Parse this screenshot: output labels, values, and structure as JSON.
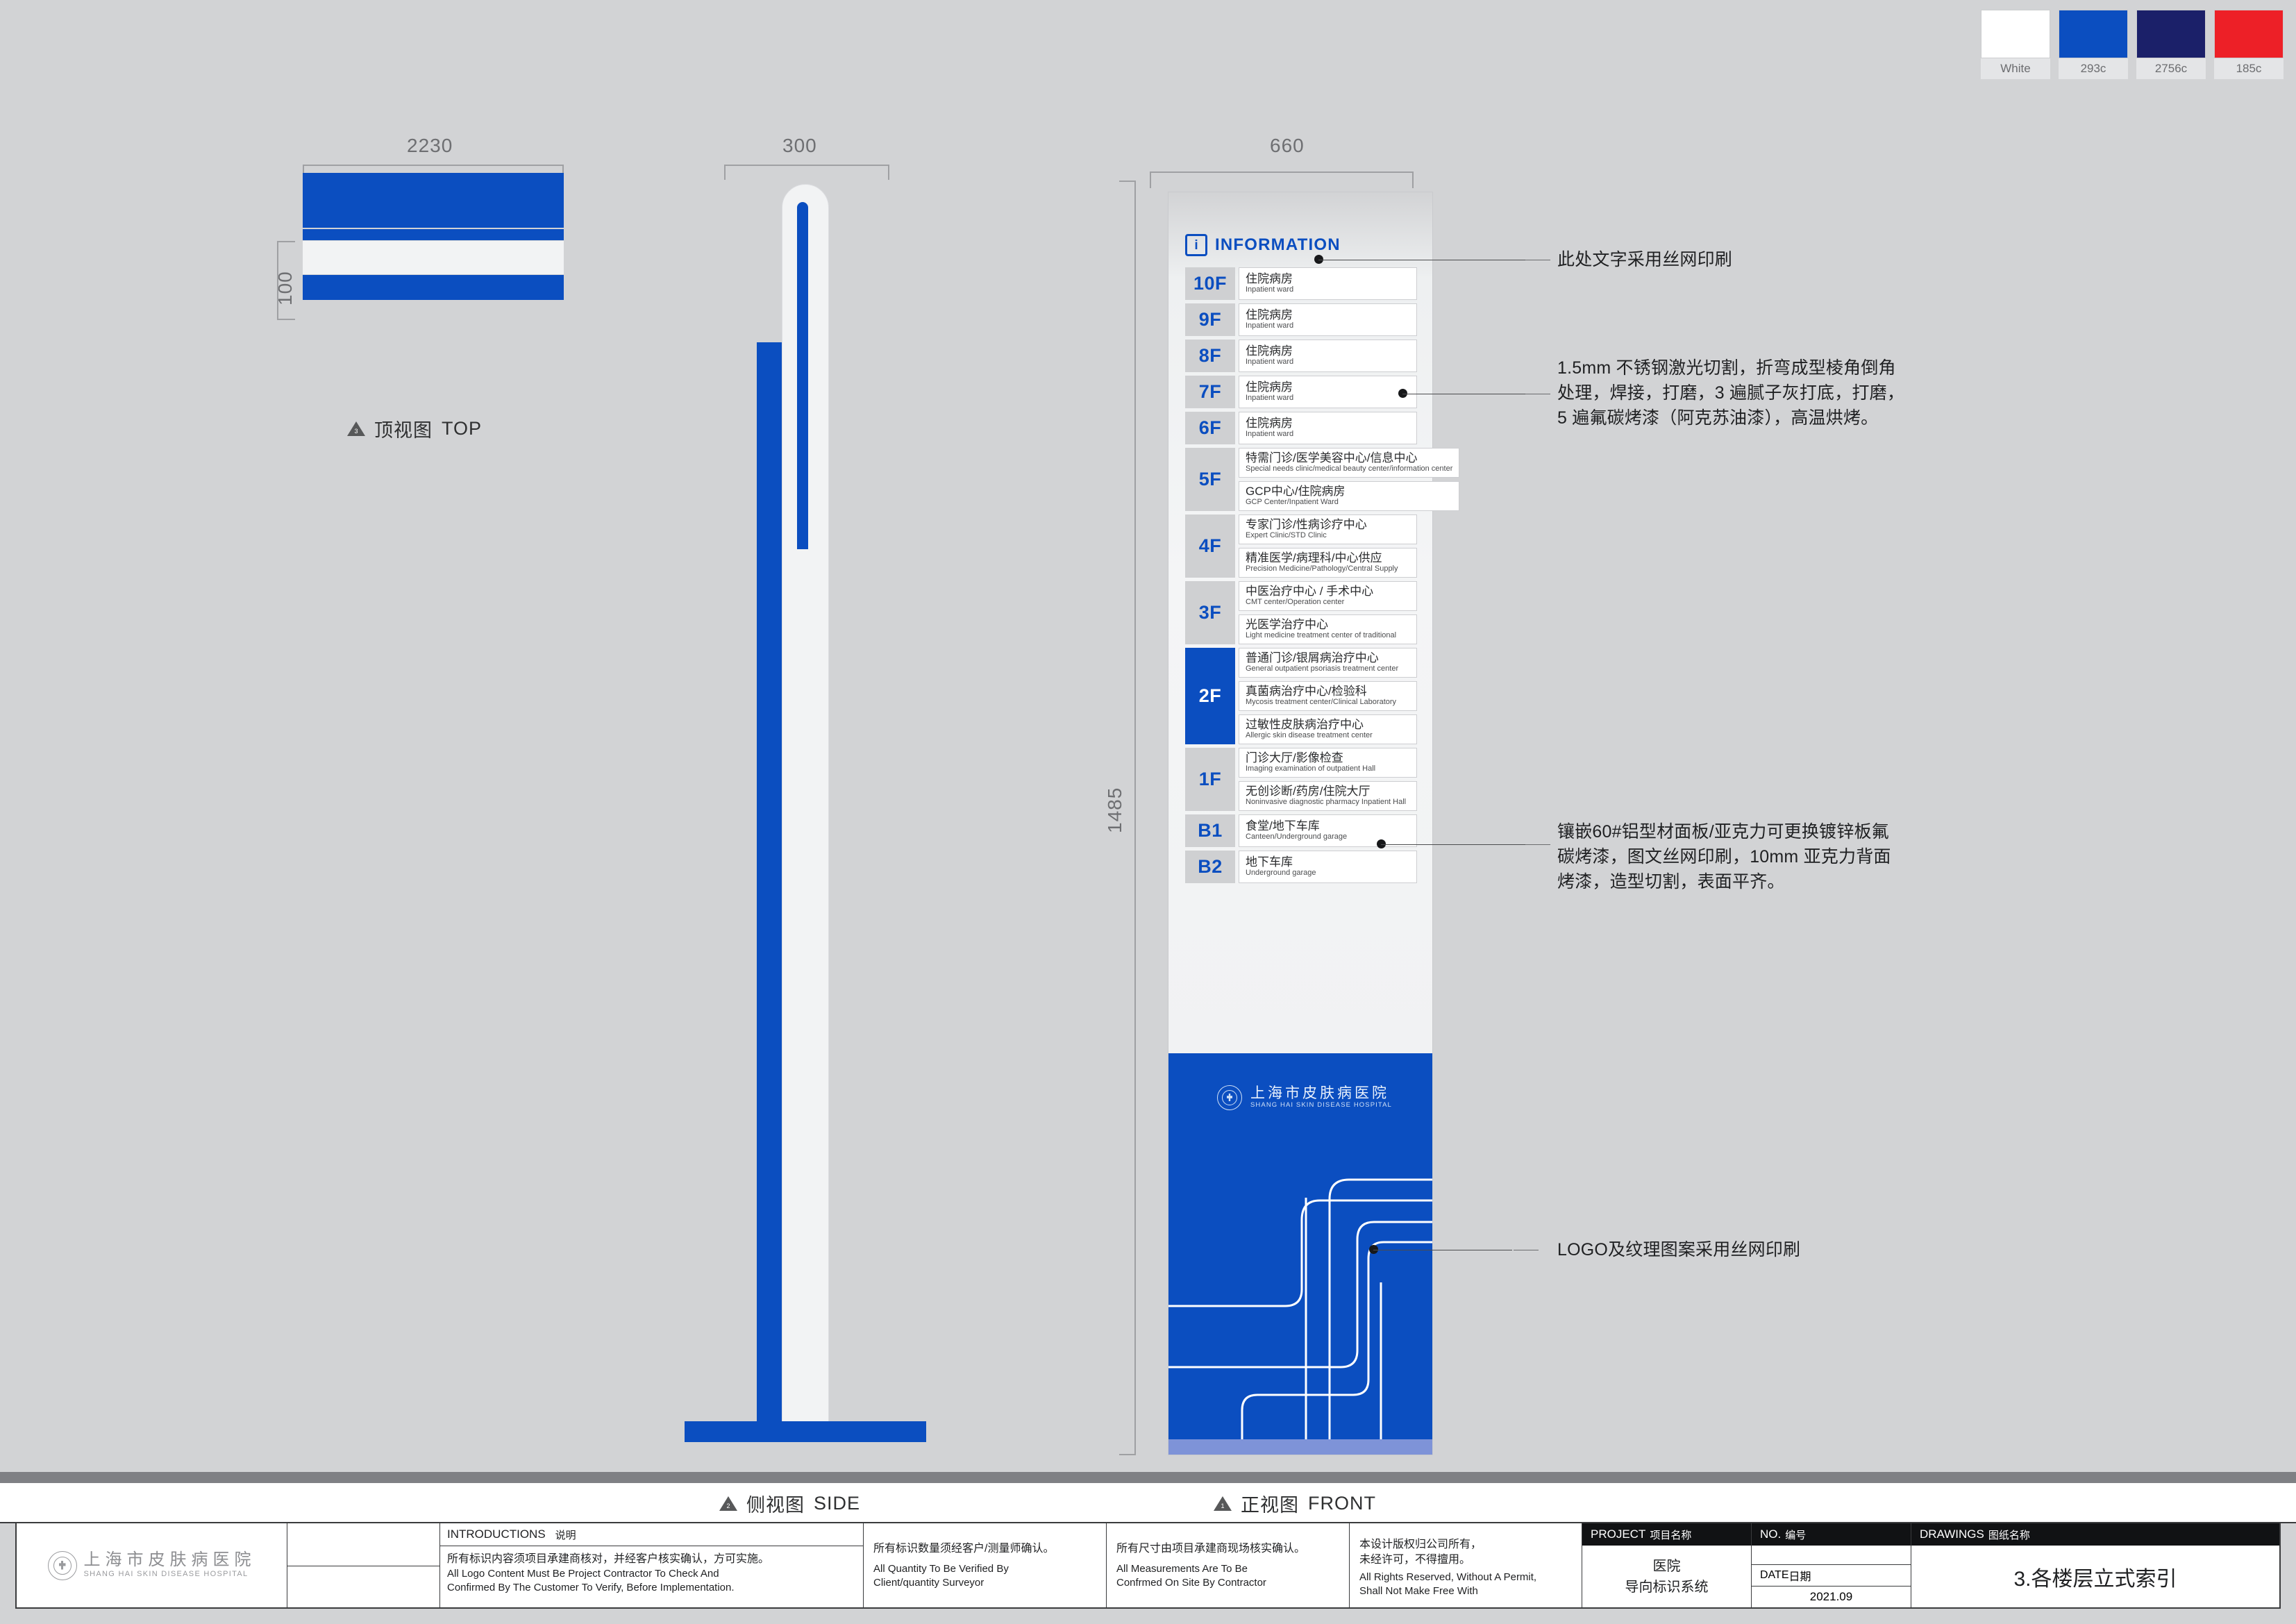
{
  "swatches": [
    {
      "name": "White",
      "hex": "#ffffff"
    },
    {
      "name": "293c",
      "hex": "#0b4ec0"
    },
    {
      "name": "2756c",
      "hex": "#1b2069"
    },
    {
      "name": "185c",
      "hex": "#ed2027"
    }
  ],
  "dimensions": {
    "top_width": "2230",
    "top_height": "100",
    "side_width": "300",
    "front_width": "660",
    "front_height": "1485"
  },
  "views": {
    "top": {
      "label_cn": "顶视图",
      "label_en": "TOP",
      "index": "3"
    },
    "side": {
      "label_cn": "侧视图",
      "label_en": "SIDE",
      "index": "2"
    },
    "front": {
      "label_cn": "正视图",
      "label_en": "FRONT",
      "index": "1"
    }
  },
  "sign": {
    "info_header": "INFORMATION",
    "info_icon": "i",
    "logo_cn": "上海市皮肤病医院",
    "logo_en": "SHANG HAI SKIN DISEASE HOSPITAL",
    "floors": [
      {
        "badge": "10F",
        "highlight": false,
        "entries": [
          {
            "cn": "住院病房",
            "en": "Inpatient ward"
          }
        ]
      },
      {
        "badge": "9F",
        "highlight": false,
        "entries": [
          {
            "cn": "住院病房",
            "en": "Inpatient ward"
          }
        ]
      },
      {
        "badge": "8F",
        "highlight": false,
        "entries": [
          {
            "cn": "住院病房",
            "en": "Inpatient ward"
          }
        ]
      },
      {
        "badge": "7F",
        "highlight": false,
        "entries": [
          {
            "cn": "住院病房",
            "en": "Inpatient ward"
          }
        ]
      },
      {
        "badge": "6F",
        "highlight": false,
        "entries": [
          {
            "cn": "住院病房",
            "en": "Inpatient ward"
          }
        ]
      },
      {
        "badge": "5F",
        "highlight": false,
        "entries": [
          {
            "cn": "特需门诊/医学美容中心/信息中心",
            "en": "Special needs clinic/medical beauty center/information center"
          },
          {
            "cn": "GCP中心/住院病房",
            "en": "GCP Center/Inpatient Ward"
          }
        ]
      },
      {
        "badge": "4F",
        "highlight": false,
        "entries": [
          {
            "cn": "专家门诊/性病诊疗中心",
            "en": "Expert Clinic/STD Clinic"
          },
          {
            "cn": "精准医学/病理科/中心供应",
            "en": "Precision Medicine/Pathology/Central Supply"
          }
        ]
      },
      {
        "badge": "3F",
        "highlight": false,
        "entries": [
          {
            "cn": "中医治疗中心 / 手术中心",
            "en": "CMT center/Operation center"
          },
          {
            "cn": "光医学治疗中心",
            "en": "Light medicine treatment center of traditional"
          }
        ]
      },
      {
        "badge": "2F",
        "highlight": true,
        "entries": [
          {
            "cn": "普通门诊/银屑病治疗中心",
            "en": "General outpatient psoriasis treatment center"
          },
          {
            "cn": "真菌病治疗中心/检验科",
            "en": "Mycosis treatment center/Clinical Laboratory"
          },
          {
            "cn": "过敏性皮肤病治疗中心",
            "en": "Allergic skin disease treatment center"
          }
        ]
      },
      {
        "badge": "1F",
        "highlight": false,
        "entries": [
          {
            "cn": "门诊大厅/影像检查",
            "en": "Imaging examination of outpatient Hall"
          },
          {
            "cn": "无创诊断/药房/住院大厅",
            "en": "Noninvasive diagnostic pharmacy Inpatient Hall"
          }
        ]
      },
      {
        "badge": "B1",
        "highlight": false,
        "entries": [
          {
            "cn": "食堂/地下车库",
            "en": "Canteen/Underground garage"
          }
        ]
      },
      {
        "badge": "B2",
        "highlight": false,
        "entries": [
          {
            "cn": "地下车库",
            "en": "Underground garage"
          }
        ]
      }
    ]
  },
  "annotations": {
    "note1": "此处文字采用丝网印刷",
    "note2_l1": "1.5mm  不锈钢激光切割，折弯成型棱角倒角",
    "note2_l2": "处理，焊接，打磨，3 遍腻子灰打底，打磨，",
    "note2_l3": "5 遍氟碳烤漆（阿克苏油漆），高温烘烤。",
    "note3_l1": "镶嵌60#铝型材面板/亚克力可更换镀锌板氟",
    "note3_l2": "碳烤漆，图文丝网印刷，10mm 亚克力背面",
    "note3_l3": "烤漆，造型切割，表面平齐。",
    "note4": "LOGO及纹理图案采用丝网印刷"
  },
  "titleblock": {
    "logo_cn": "上海市皮肤病医院",
    "logo_en": "SHANG HAI SKIN DISEASE HOSPITAL",
    "intro_header_en": "INTRODUCTIONS",
    "intro_header_cn": "说明",
    "intro_cn": "所有标识内容须项目承建商核对，并经客户核实确认，方可实施。",
    "intro_en_l1": "All Logo Content Must Be Project Contractor To Check And",
    "intro_en_l2": "Confirmed By The Customer To Verify, Before Implementation.",
    "note2_cn": "所有标识数量须经客户/测量师确认。",
    "note2_en_l1": "All Quantity To Be Verified By",
    "note2_en_l2": "Client/quantity Surveyor",
    "note3_cn": "所有尺寸由项目承建商现场核实确认。",
    "note3_en_l1": "All Measurements Are To Be",
    "note3_en_l2": "Confrmed On Site By Contractor",
    "note4_cn_l1": "本设计版权归公司所有，",
    "note4_cn_l2": "未经许可，不得擅用。",
    "note4_en_l1": "All Rights Reserved, Without A Permit,",
    "note4_en_l2": "Shall Not Make Free With",
    "project_header_en": "PROJECT",
    "project_header_cn": "项目名称",
    "project_l1": "医院",
    "project_l2": "导向标识系统",
    "no_header_en": "NO.",
    "no_header_cn": "编号",
    "date_label_en": "DATE",
    "date_label_cn": "日期",
    "date_value": "2021.09",
    "drawings_header_en": "DRAWINGS",
    "drawings_header_cn": "图纸名称",
    "drawings_value": "3.各楼层立式索引"
  }
}
